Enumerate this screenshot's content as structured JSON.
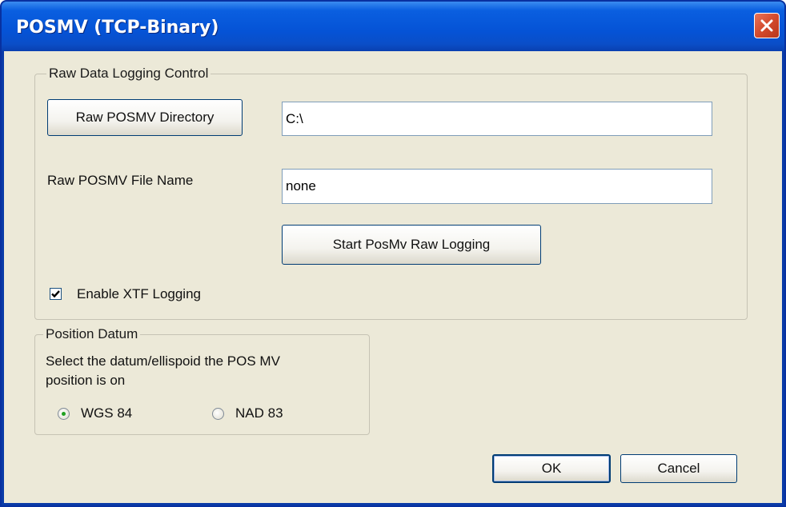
{
  "window": {
    "title": "POSMV (TCP-Binary)",
    "close_icon": "close-icon",
    "colors": {
      "titlebar": "#0553d6",
      "close_button": "#d34a2c",
      "client_background": "#ece9d8"
    }
  },
  "raw_logging": {
    "group_label": "Raw Data Logging Control",
    "directory_button_label": "Raw POSMV Directory",
    "directory_value": "C:\\",
    "file_name_label": "Raw POSMV File Name",
    "file_name_value": "none",
    "start_button_label": "Start PosMv Raw Logging",
    "xtf_checkbox_label": "Enable XTF Logging",
    "xtf_checked": true
  },
  "position_datum": {
    "group_label": "Position Datum",
    "description_line1": "Select the datum/ellispoid the POS MV",
    "description_line2": "position is on",
    "options": [
      {
        "label": "WGS 84",
        "selected": true
      },
      {
        "label": "NAD 83",
        "selected": false
      }
    ]
  },
  "footer": {
    "ok_label": "OK",
    "cancel_label": "Cancel"
  }
}
